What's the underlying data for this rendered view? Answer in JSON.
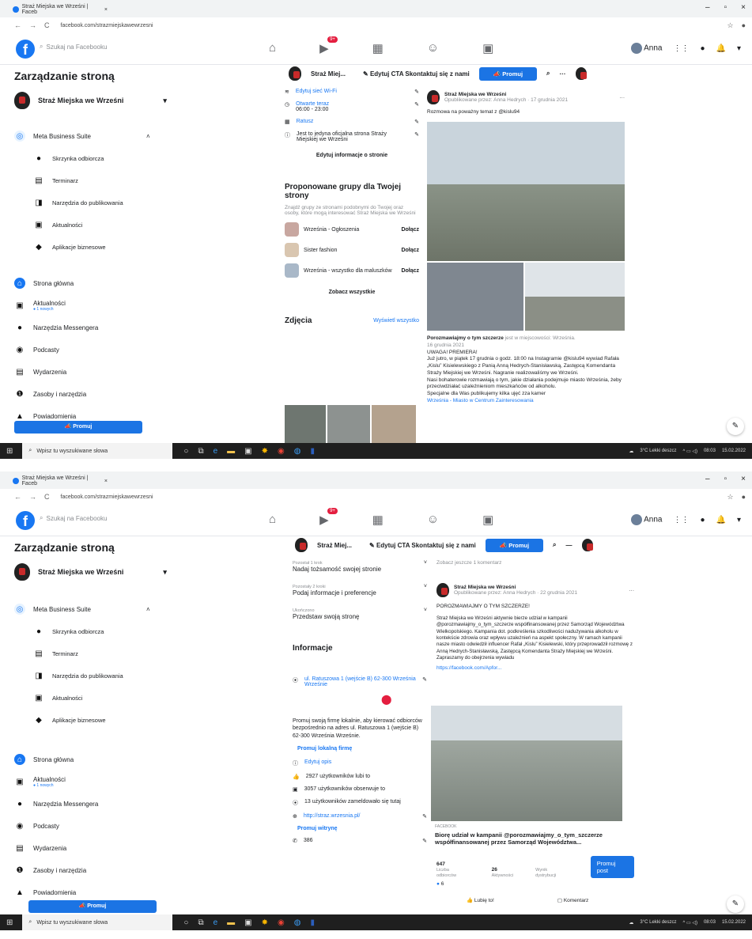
{
  "browser": {
    "tab_title_1": "Straż Miejska we Wrześni | Faceb",
    "tab_title_2": "Straż Miejska we Wrześni | Faceb",
    "url_1": "facebook.com/strazmiejskawewrzesni",
    "url_2": "facebook.com/strazmiejskawewrzesni"
  },
  "topbar": {
    "search_placeholder": "Szukaj na Facebooku",
    "video_badge": "9+",
    "user_name": "Anna"
  },
  "sidebar": {
    "title": "Zarządzanie stroną",
    "page_name": "Straż Miejska we Wrześni",
    "meta": "Meta Business Suite",
    "meta_items": [
      "Skrzynka odbiorcza",
      "Terminarz",
      "Narzędzia do publikowania",
      "Aktualności",
      "Aplikacje biznesowe"
    ],
    "home": "Strona główna",
    "news": "Aktualności",
    "news_sub": "● 1 nowych",
    "items": [
      "Narzędzia Messengera",
      "Podcasty",
      "Wydarzenia",
      "Zasoby i narzędzia",
      "Powiadomienia"
    ],
    "promote": "Promuj"
  },
  "pagebar": {
    "page_short": "Straż Miej...",
    "cta": "Edytuj CTA Skontaktuj się z nami",
    "promote": "Promuj"
  },
  "shot1": {
    "about": [
      {
        "label": "Edytuj sieć Wi-Fi",
        "sub": ""
      },
      {
        "label": "Otwarte teraz",
        "sub": "06:00 - 23:00"
      },
      {
        "label": "Ratusz",
        "sub": ""
      },
      {
        "label": "Jest to jedyna oficjalna strona Straży Miejskiej we Wrześni",
        "sub": ""
      }
    ],
    "edit_info": "Edytuj informacje o stronie",
    "groups_title": "Proponowane grupy dla Twojej strony",
    "groups_desc": "Znajdź grupy ze stronami podobnymi do Twojej oraz osoby, które mogą interesować Straż Miejska we Wrześni",
    "groups": [
      {
        "name": "Września - Ogłoszenia",
        "join": "Dołącz"
      },
      {
        "name": "Sister fashion",
        "join": "Dołącz"
      },
      {
        "name": "Września - wszystko dla maluszków",
        "join": "Dołącz"
      }
    ],
    "see_all": "Zobacz wszystkie",
    "photos": "Zdjęcia",
    "photos_link": "Wyświetl wszystko",
    "post_author": "Straż Miejska we Wrześni",
    "post_meta": "Opublikowane przez: Anna Hedrych · 17 grudnia 2021",
    "post_text": "Rozmowa na poważny temat z @kislu94",
    "caption_title": "Porozmawiajmy o tym szczerze",
    "caption_place": "jest w miejscowości: Września.",
    "caption_date": "16 grudnia 2021",
    "caption_lines": [
      "UWAGA! PREMIERA!",
      "Już jutro, w piątek 17 grudnia o godz. 18:00 na Instagramie @kislu94 wywiad Rafała „Kislu” Kisielewskiego z Panią Anną Hedrych-Stanisławską, Zastępcą Komendanta Straży Miejskiej we Wrześni. Nagranie realizowaliśmy we Wrześni.",
      "Nasi bohaterowie rozmawiają o tym, jakie działania podejmuje miasto Września, żeby przeciwdziałać uzależnieniom mieszkańców od alkoholu.",
      "Specjalne dla Was publikujemy kilka ujęć zza kamer",
      "Września - Miasto w Centrum Zainteresowania"
    ]
  },
  "shot2": {
    "tasks": [
      {
        "pre": "Pozostał 1 krok",
        "label": "Nadaj tożsamość swojej stronie"
      },
      {
        "pre": "Pozostały 2 kroki",
        "label": "Podaj informacje i preferencje"
      },
      {
        "pre": "Ukończono",
        "label": "Przedstaw swoją stronę"
      }
    ],
    "info_title": "Informacje",
    "address": "ul. Ratuszowa 1 (wejście B) 62-300 Września Wrześnie",
    "promo_text": "Promuj swoją firmę lokalnie, aby kierować odbiorców bezpośrednio na adres ul. Ratuszowa 1 (wejście B) 62-300 Września Wrześnie.",
    "promo_link": "Promuj lokalną firmę",
    "stats": [
      "Edytuj opis",
      "2927 użytkowników lubi to",
      "3057 użytkowników obserwuje to",
      "13 użytkowników zameldowało się tutaj",
      "http://straz.wrzesnia.pl/"
    ],
    "promo_site": "Promuj witrynę",
    "phone": "386",
    "comments_link": "Zobacz jeszcze 1 komentarz",
    "post_author": "Straż Miejska we Wrześni",
    "post_meta": "Opublikowane przez: Anna Hedrych · 22 grudnia 2021",
    "post_heading": "POROZMAWIAJMY O TYM SZCZERZE!",
    "post_body": "Straż Miejska we Wrześni aktywnie bierze udział w kampanii @porozmawiajmy_o_tym_szczerze współfinansowanej przez Samorząd Województwa Wielkopolskiego. Kampania dot. podkreślenia szkodliwości nadużywania alkoholu w kontekście zdrowia oraz wpływu uzależnień na aspekt społeczny. W ramach kampanii nasze miasto odwiedził influencer Rafał „Kislu” Kisielewski, który przeprowadził rozmowę z Anną Hedrych-Stanisławską, Zastępcą Komendanta Straży Miejskiej we Wrześni. Zapraszamy do obejrzenia wywiadu",
    "post_link": "https://facebook.com/Apfor...",
    "link_domain": "FACEBOOK",
    "link_title": "Biorę udział w kampanii @porozmawiajmy_o_tym_szczerze współfinansowanej przez Samorząd Województwa...",
    "stat1_val": "647",
    "stat1_lbl": "Liczba odbiorców",
    "stat2_val": "26",
    "stat2_lbl": "Aktywności",
    "stat3_lbl": "Wynik dystrybucji",
    "promote_post": "Promuj post",
    "reactions": "6",
    "like": "Lubię to!",
    "comment": "Komentarz"
  },
  "taskbar": {
    "search": "Wpisz tu wyszukiwane słowa",
    "weather": "3°C Lekki deszcz",
    "time": "08:03",
    "date": "15.02.2022"
  }
}
